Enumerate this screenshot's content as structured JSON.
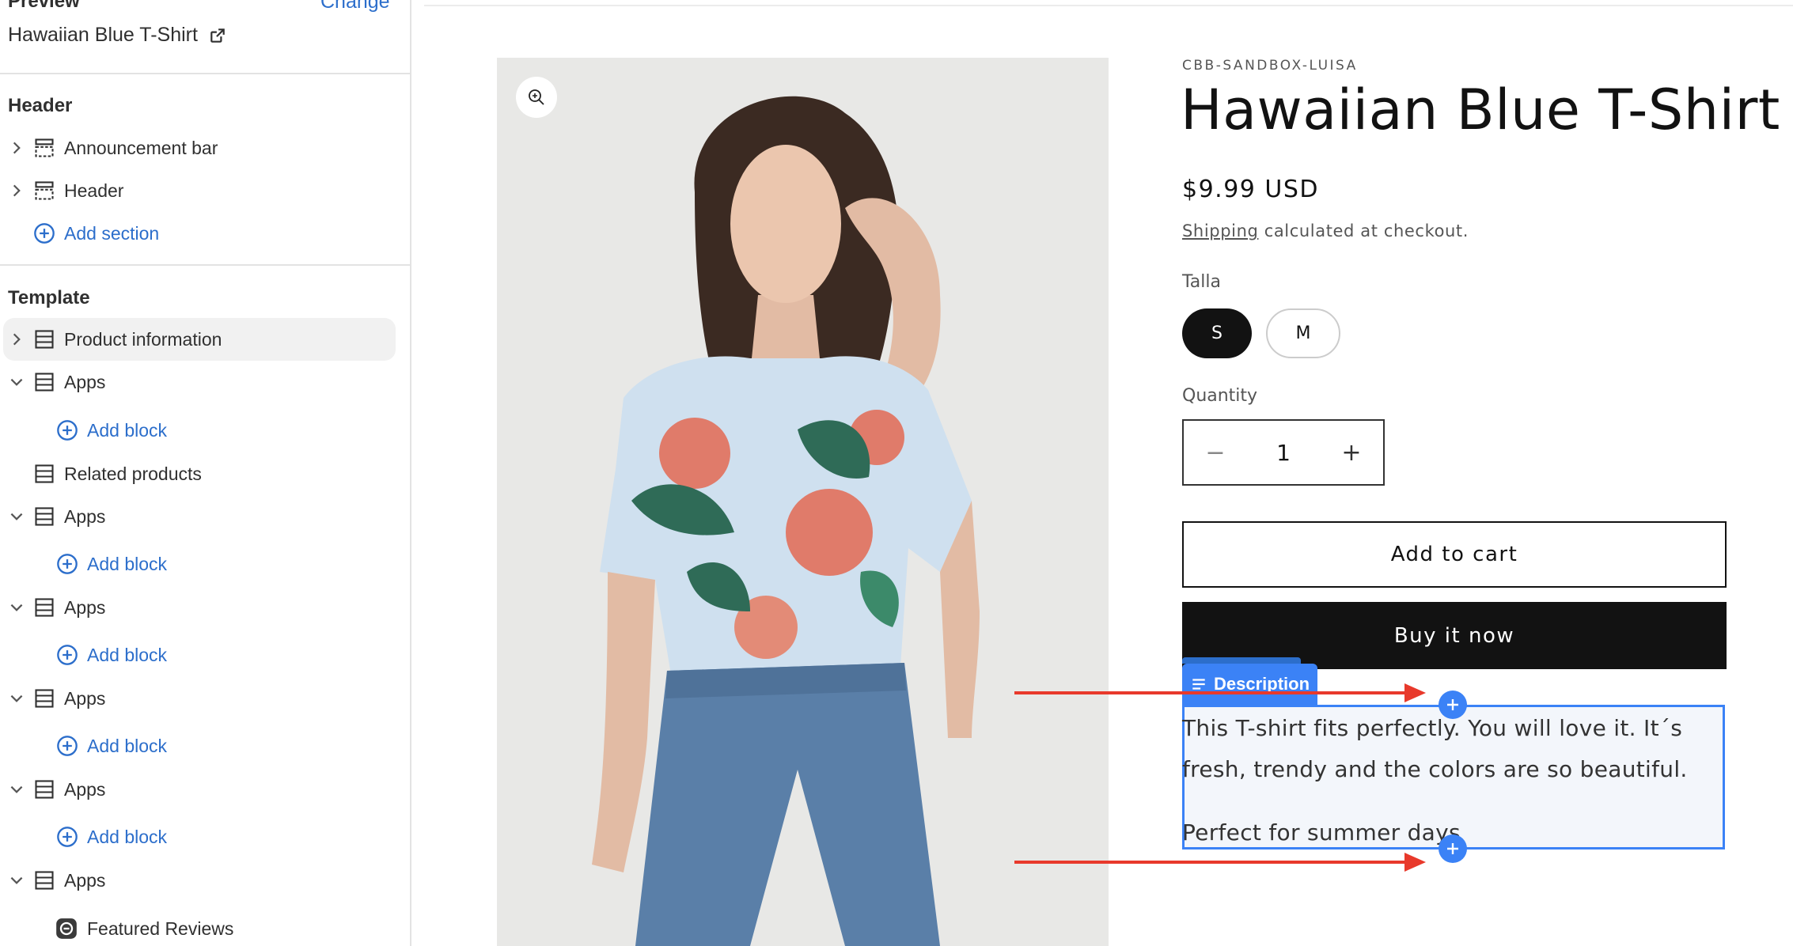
{
  "sidebar": {
    "preview_heading": "Preview",
    "change_label": "Change",
    "product_name": "Hawaiian Blue T-Shirt",
    "header_heading": "Header",
    "header_items": [
      {
        "label": "Announcement bar"
      },
      {
        "label": "Header"
      }
    ],
    "add_section_label": "Add section",
    "template_heading": "Template",
    "template_items": [
      {
        "label": "Product information",
        "selected": true
      },
      {
        "label": "Apps"
      },
      {
        "label": "Add block"
      },
      {
        "label": "Related products"
      },
      {
        "label": "Apps"
      },
      {
        "label": "Add block"
      },
      {
        "label": "Apps"
      },
      {
        "label": "Add block"
      },
      {
        "label": "Apps"
      },
      {
        "label": "Add block"
      },
      {
        "label": "Apps"
      },
      {
        "label": "Add block"
      },
      {
        "label": "Apps"
      },
      {
        "label": "Featured Reviews"
      }
    ]
  },
  "product": {
    "vendor": "CBB-SANDBOX-LUISA",
    "title": "Hawaiian Blue T-Shirt",
    "price": "$9.99 USD",
    "shipping_link": "Shipping",
    "shipping_rest": " calculated at checkout.",
    "option_label": "Talla",
    "sizes": [
      "S",
      "M"
    ],
    "selected_size": "S",
    "quantity_label": "Quantity",
    "quantity": "1",
    "qty_minus": "−",
    "qty_plus": "+",
    "add_to_cart": "Add to cart",
    "buy_now": "Buy it now",
    "description_tab": "Description",
    "description_p1": "This T-shirt fits perfectly. You will love it. It´s fresh, trendy and the colors are so beautiful.",
    "description_p2": "Perfect for summer days"
  },
  "colors": {
    "accent_blue": "#3b82f6",
    "link_blue": "#2c6ecb",
    "annotation_arrow": "#e8392b",
    "button_dark": "#121212"
  },
  "icons": {
    "external": "external-link-icon",
    "zoom": "zoom-in-icon",
    "section": "section-icon",
    "add": "plus-circle-icon",
    "chevron": "chevron-icon",
    "description": "text-lines-icon",
    "reviews_app": "reviews-app-icon"
  }
}
